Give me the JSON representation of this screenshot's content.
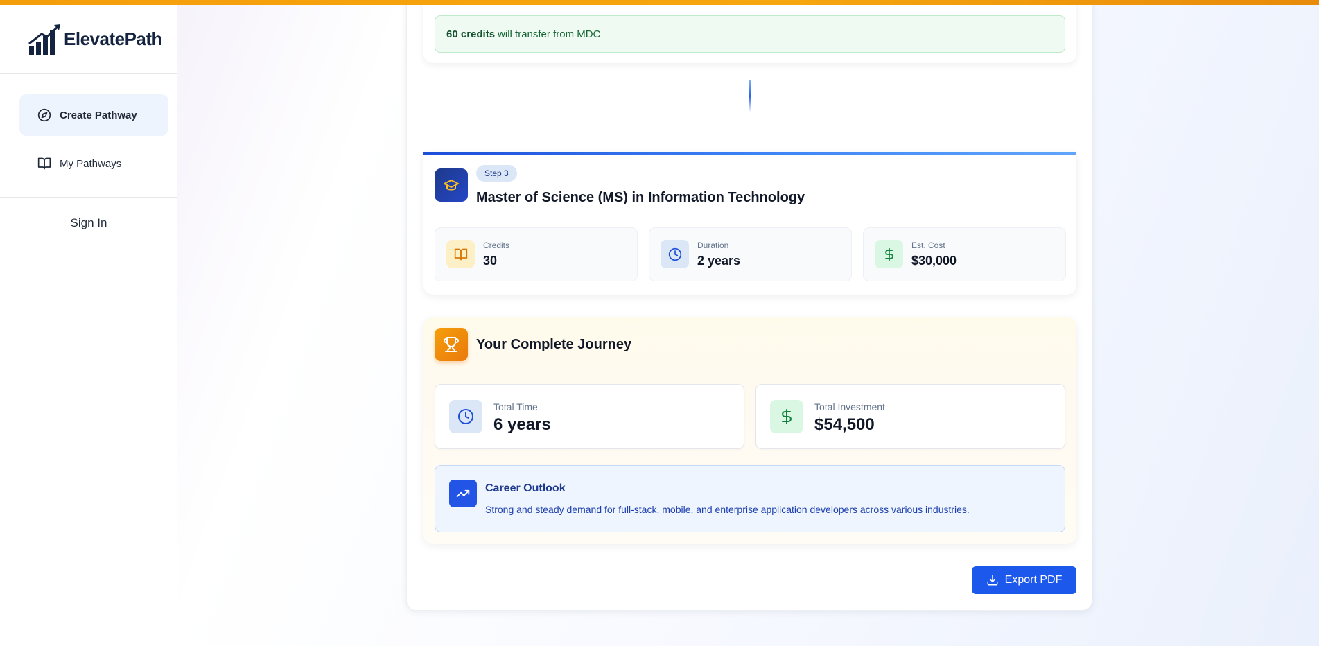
{
  "app": {
    "name": "ElevatePath"
  },
  "sidebar": {
    "items": [
      {
        "label": "Create Pathway",
        "icon": "compass-icon",
        "active": true
      },
      {
        "label": "My Pathways",
        "icon": "book-open-icon",
        "active": false
      }
    ],
    "sign_in": "Sign In"
  },
  "transfer": {
    "credits": "60 credits",
    "text": "will transfer from MDC"
  },
  "step": {
    "badge": "Step 3",
    "title": "Master of Science (MS) in Information Technology",
    "icon": "graduation-cap-icon",
    "stats": [
      {
        "label": "Credits",
        "value": "30",
        "icon": "book-open-icon",
        "color": "#d97706"
      },
      {
        "label": "Duration",
        "value": "2 years",
        "icon": "clock-icon",
        "color": "#1d4ed8"
      },
      {
        "label": "Est. Cost",
        "value": "$30,000",
        "icon": "dollar-icon",
        "color": "#15803d"
      }
    ]
  },
  "journey": {
    "title": "Your Complete Journey",
    "icon": "trophy-icon",
    "total_time": {
      "label": "Total Time",
      "value": "6 years"
    },
    "total_investment": {
      "label": "Total Investment",
      "value": "$54,500"
    },
    "outlook": {
      "title": "Career Outlook",
      "text": "Strong and steady demand for full-stack, mobile, and enterprise application developers across various industries."
    }
  },
  "export": {
    "label": "Export PDF"
  },
  "colors": {
    "accent": "#1d58ec",
    "top_bar": "#f59e0b"
  }
}
